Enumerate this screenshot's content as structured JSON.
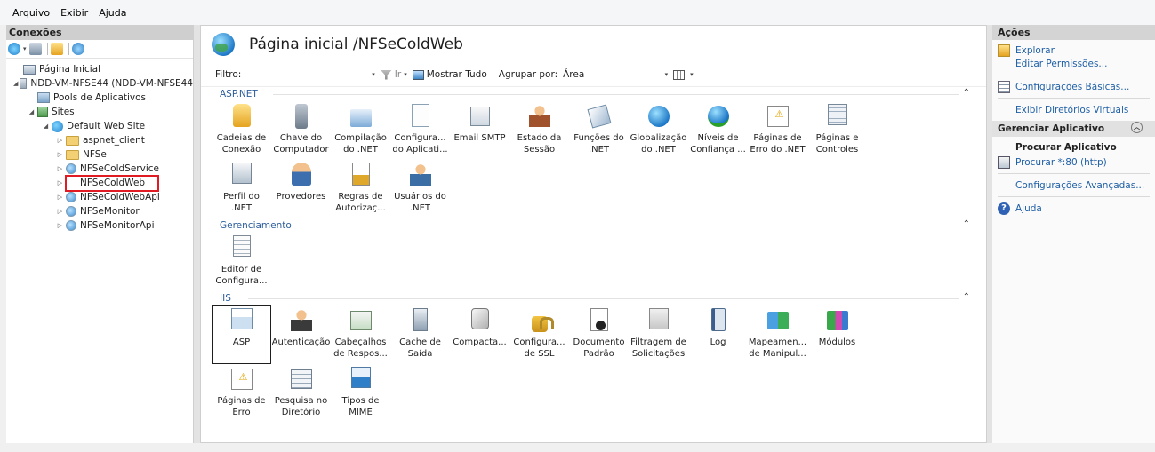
{
  "menu": [
    "Arquivo",
    "Exibir",
    "Ajuda"
  ],
  "connections": {
    "header": "Conexões",
    "tree": [
      {
        "label": "Página Inicial",
        "icon": "home-page-icon",
        "level": 0,
        "twisty": ""
      },
      {
        "label": "NDD-VM-NFSE44 (NDD-VM-NFSE44",
        "icon": "server-icon",
        "level": 0,
        "twisty": "◢"
      },
      {
        "label": "Pools de Aplicativos",
        "icon": "app-pools-icon",
        "level": 1,
        "twisty": ""
      },
      {
        "label": "Sites",
        "icon": "sites-icon",
        "level": 1,
        "twisty": "◢"
      },
      {
        "label": "Default Web Site",
        "icon": "globe-icon",
        "level": 2,
        "twisty": "◢"
      },
      {
        "label": "aspnet_client",
        "icon": "folder-icon",
        "level": 3,
        "twisty": "▷"
      },
      {
        "label": "NFSe",
        "icon": "folder-icon",
        "level": 3,
        "twisty": "▷"
      },
      {
        "label": "NFSeColdService",
        "icon": "web-app-icon",
        "level": 3,
        "twisty": "▷"
      },
      {
        "label": "NFSeColdWeb",
        "icon": "web-app-icon",
        "level": 3,
        "twisty": "▷"
      },
      {
        "label": "NFSeColdWebApi",
        "icon": "web-app-icon",
        "level": 3,
        "twisty": "▷"
      },
      {
        "label": "NFSeMonitor",
        "icon": "web-app-icon",
        "level": 3,
        "twisty": "▷"
      },
      {
        "label": "NFSeMonitorApi",
        "icon": "web-app-icon",
        "level": 3,
        "twisty": "▷"
      }
    ],
    "selected_index": 8
  },
  "center": {
    "title": "Página inicial /NFSeColdWeb",
    "filter": {
      "label": "Filtro:",
      "value": "",
      "go_label": "Ir",
      "show_all_label": "Mostrar Tudo",
      "group_by_label": "Agrupar por:",
      "group_by_value": "Área"
    },
    "sections": [
      {
        "title": "ASP.NET",
        "features": [
          {
            "label": "Cadeias de Conexão",
            "icon": "connection-strings-icon"
          },
          {
            "label": "Chave do Computador",
            "icon": "machine-key-icon"
          },
          {
            "label": "Compilação do .NET",
            "icon": "compilation-icon"
          },
          {
            "label": "Configura... do Aplicati...",
            "icon": "app-settings-icon"
          },
          {
            "label": "Email SMTP",
            "icon": "smtp-email-icon"
          },
          {
            "label": "Estado da Sessão",
            "icon": "session-state-icon"
          },
          {
            "label": "Funções do .NET",
            "icon": "net-roles-icon"
          },
          {
            "label": "Globalização do .NET",
            "icon": "globalization-icon"
          },
          {
            "label": "Níveis de Confiança ...",
            "icon": "trust-levels-icon"
          },
          {
            "label": "Páginas de Erro do .NET",
            "icon": "error-pages-icon"
          },
          {
            "label": "Páginas e Controles",
            "icon": "pages-controls-icon"
          },
          {
            "label": "Perfil do .NET",
            "icon": "profile-icon"
          },
          {
            "label": "Provedores",
            "icon": "providers-icon"
          },
          {
            "label": "Regras de Autorizaç...",
            "icon": "authorization-rules-icon"
          },
          {
            "label": "Usuários do .NET",
            "icon": "net-users-icon"
          }
        ]
      },
      {
        "title": "Gerenciamento",
        "features": [
          {
            "label": "Editor de Configura...",
            "icon": "config-editor-icon"
          }
        ]
      },
      {
        "title": "IIS",
        "features": [
          {
            "label": "ASP",
            "icon": "asp-icon"
          },
          {
            "label": "Autenticação",
            "icon": "authentication-icon"
          },
          {
            "label": "Cabeçalhos de Respos...",
            "icon": "response-headers-icon"
          },
          {
            "label": "Cache de Saída",
            "icon": "output-cache-icon"
          },
          {
            "label": "Compacta...",
            "icon": "compression-icon"
          },
          {
            "label": "Configura... de SSL",
            "icon": "ssl-settings-icon"
          },
          {
            "label": "Documento Padrão",
            "icon": "default-document-icon"
          },
          {
            "label": "Filtragem de Solicitações",
            "icon": "request-filtering-icon"
          },
          {
            "label": "Log",
            "icon": "logging-icon"
          },
          {
            "label": "Mapeamen... de Manipul...",
            "icon": "handler-mappings-icon"
          },
          {
            "label": "Módulos",
            "icon": "modules-icon"
          },
          {
            "label": "Páginas de Erro",
            "icon": "error-pages-icon"
          },
          {
            "label": "Pesquisa no Diretório",
            "icon": "directory-browsing-icon"
          },
          {
            "label": "Tipos de MIME",
            "icon": "mime-types-icon"
          }
        ]
      }
    ]
  },
  "actions": {
    "header": "Ações",
    "explore": "Explorar",
    "edit_permissions": "Editar Permissões...",
    "basic_settings": "Configurações Básicas...",
    "view_virtual_dirs": "Exibir Diretórios Virtuais",
    "manage_app_header": "Gerenciar Aplicativo",
    "browse_app_header": "Procurar Aplicativo",
    "browse_http": "Procurar *:80 (http)",
    "advanced_settings": "Configurações Avançadas...",
    "help": "Ajuda"
  }
}
